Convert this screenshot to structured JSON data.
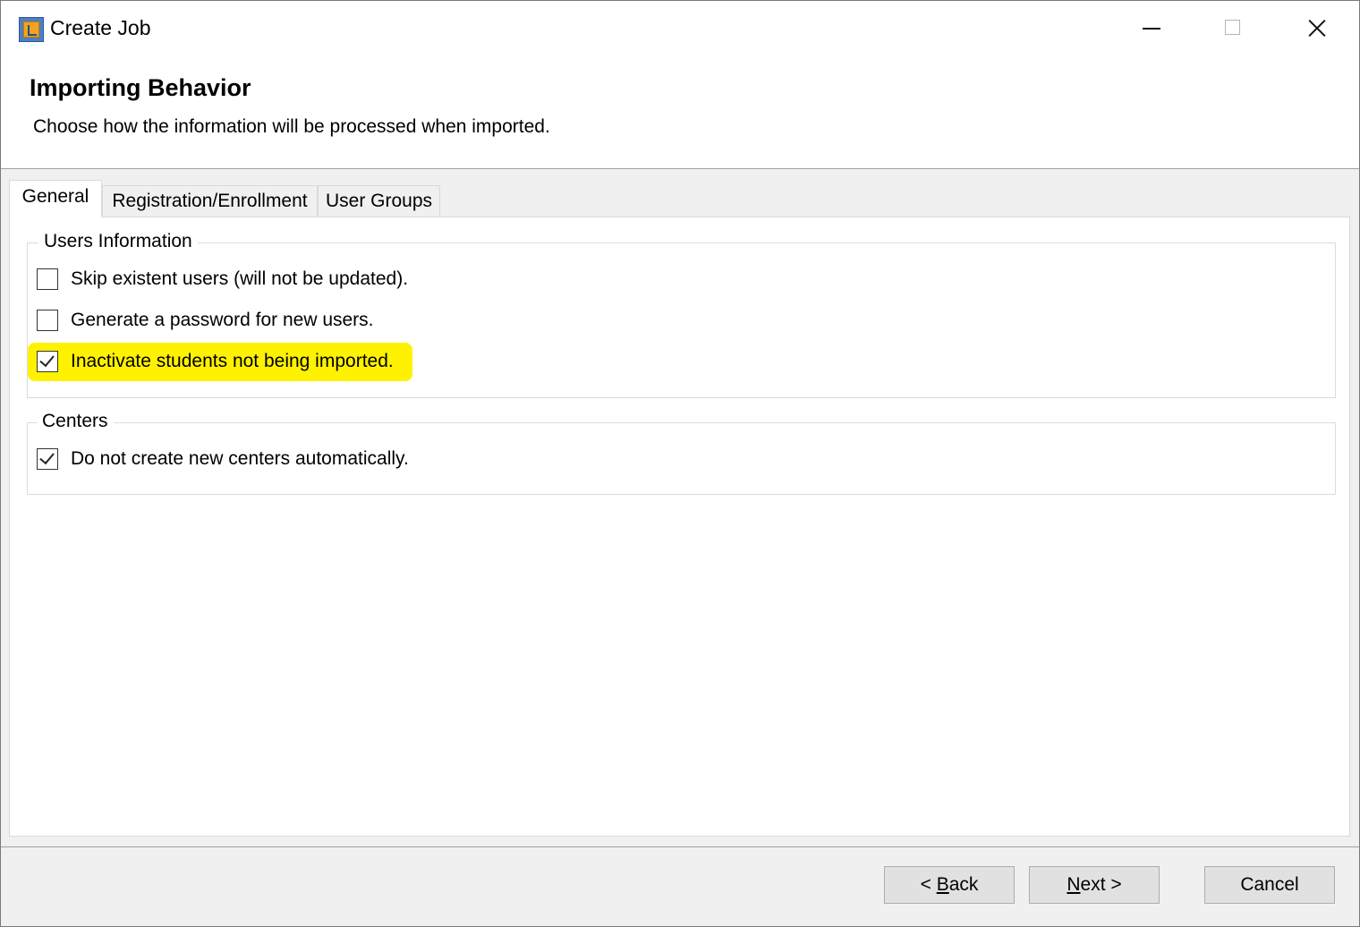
{
  "window": {
    "title": "Create Job",
    "icon": "app-icon"
  },
  "header": {
    "title": "Importing Behavior",
    "subtitle": "Choose how the information will be processed when imported."
  },
  "tabs": [
    {
      "label": "General",
      "active": true
    },
    {
      "label": "Registration/Enrollment",
      "active": false
    },
    {
      "label": "User Groups",
      "active": false
    }
  ],
  "users_group": {
    "legend": "Users Information",
    "options": [
      {
        "label": "Skip existent users (will not be updated).",
        "checked": false
      },
      {
        "label": "Generate a password for new users.",
        "checked": false
      },
      {
        "label": "Inactivate students not being imported.",
        "checked": true,
        "highlighted": true
      }
    ]
  },
  "centers_group": {
    "legend": "Centers",
    "options": [
      {
        "label": "Do not create new centers automatically.",
        "checked": true
      }
    ]
  },
  "buttons": {
    "back_prefix": "< ",
    "back_mnemonic": "B",
    "back_rest": "ack",
    "next_mnemonic": "N",
    "next_rest": "ext >",
    "cancel": "Cancel"
  },
  "colors": {
    "highlight": "#fff200",
    "window_bg": "#f0f0f0",
    "button_bg": "#e1e1e1"
  }
}
